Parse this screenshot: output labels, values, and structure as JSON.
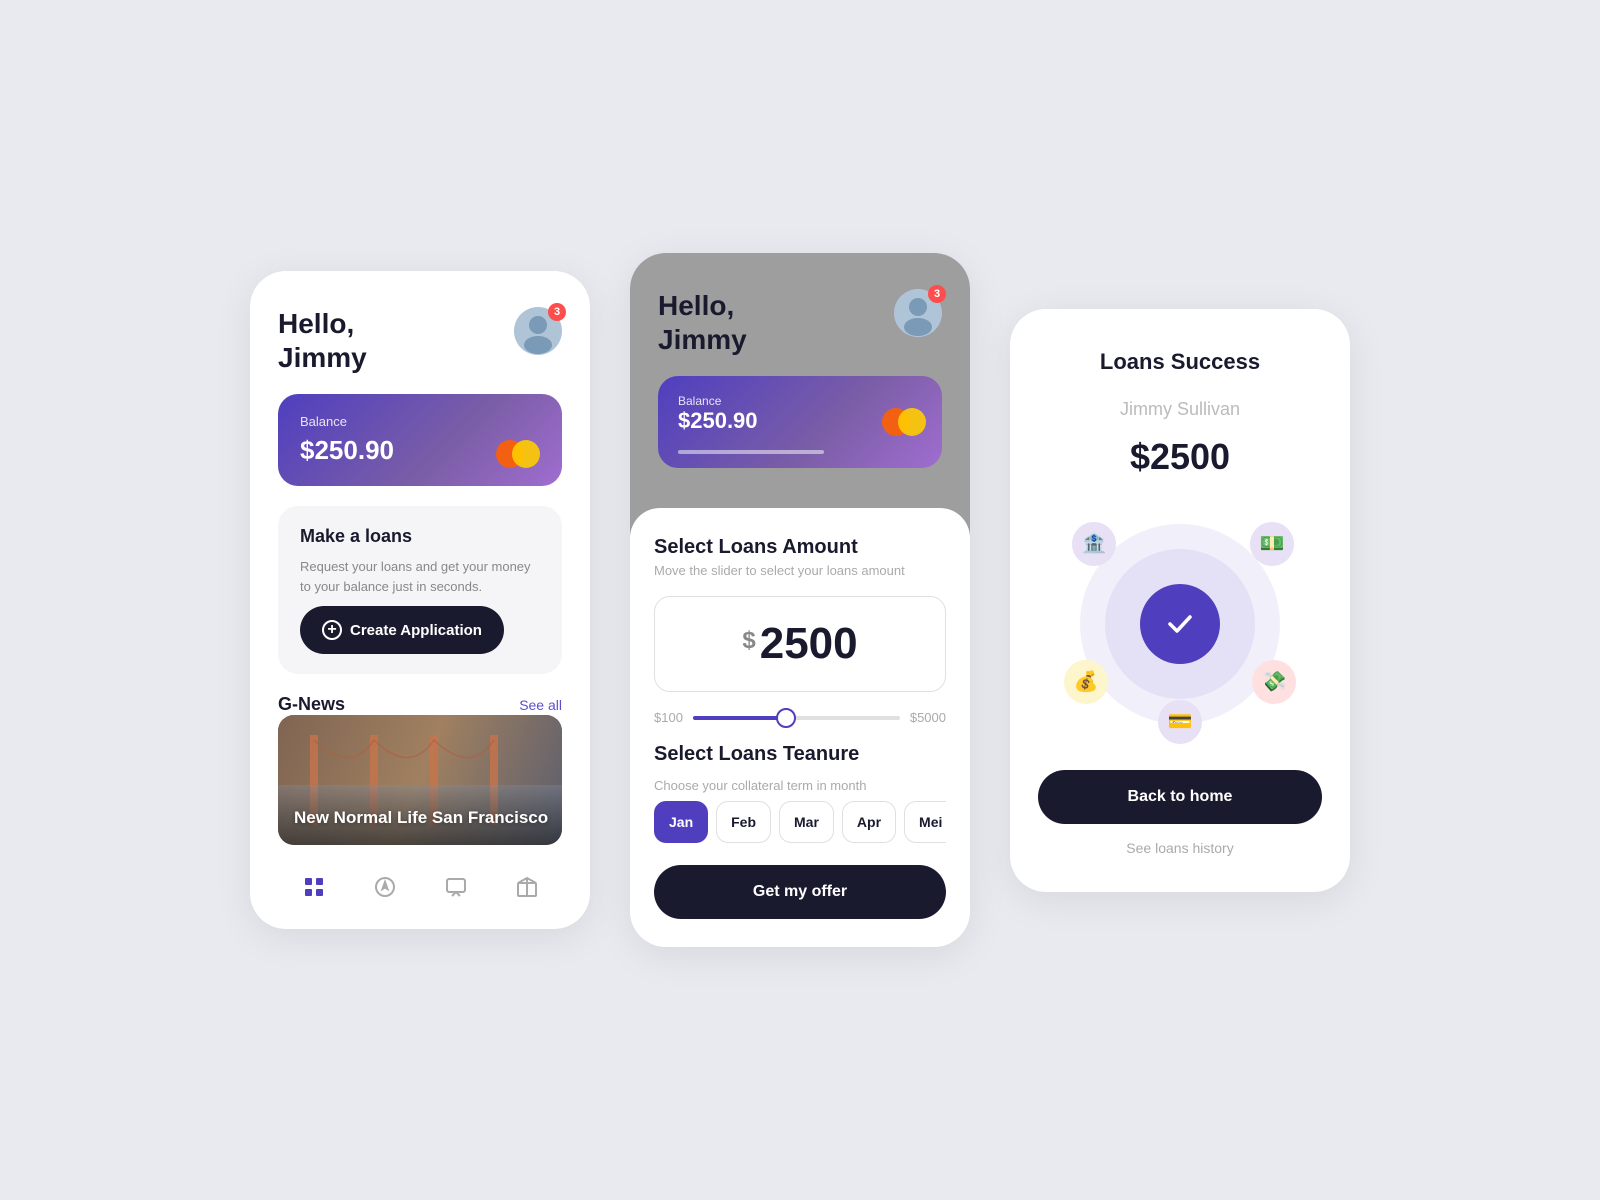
{
  "screen1": {
    "greeting_line1": "Hello,",
    "greeting_name": "Jimmy",
    "badge_count": "3",
    "balance_label": "Balance",
    "balance_amount": "$250.90",
    "loans_title": "Make a loans",
    "loans_desc": "Request your loans and get your money to your balance just in seconds.",
    "create_btn_label": "Create Application",
    "gnews_title": "G-News",
    "see_all_label": "See all",
    "news_title": "New Normal Life San Francisco"
  },
  "screen2": {
    "greeting_line1": "Hello,",
    "greeting_name": "Jimmy",
    "badge_count": "3",
    "balance_label": "Balance",
    "balance_amount": "$250.90",
    "select_amount_title": "Select Loans Amount",
    "select_amount_sub": "Move the slider to select your loans amount",
    "amount_value": "2500",
    "slider_min": "$100",
    "slider_max": "$5000",
    "tenure_title": "Select Loans Teanure",
    "tenure_sub": "Choose your collateral term in month",
    "months": [
      "Jan",
      "Feb",
      "Mar",
      "Apr",
      "Mei"
    ],
    "active_month": "Jan",
    "get_offer_label": "Get my offer"
  },
  "screen3": {
    "title": "Loans Success",
    "user_name": "Jimmy Sullivan",
    "amount": "$2500",
    "back_home_label": "Back to home",
    "see_history_label": "See loans history"
  },
  "icons": {
    "bank": "🏦",
    "money_stack": "💵",
    "money_bag": "💰",
    "cash": "💸",
    "credit_card": "💳",
    "checkmark": "✓"
  }
}
